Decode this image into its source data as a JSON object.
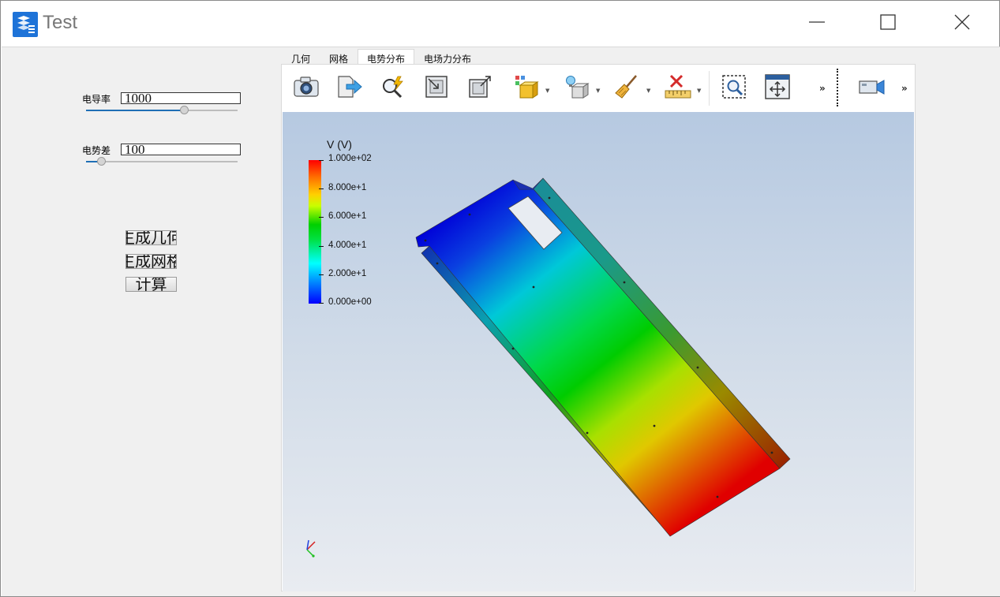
{
  "window": {
    "title": "Test"
  },
  "left_panel": {
    "conductivity": {
      "label": "电导率",
      "value": "1000",
      "slider_fraction": 0.66
    },
    "potential_diff": {
      "label": "电势差",
      "value": "100",
      "slider_fraction": 0.08
    },
    "buttons": {
      "gen_geometry": "生成几何",
      "gen_mesh": "生成网格",
      "compute": "计算"
    }
  },
  "tabs": [
    {
      "label": "几何"
    },
    {
      "label": "网格"
    },
    {
      "label": "电势分布"
    },
    {
      "label": "电场力分布"
    }
  ],
  "active_tab": "电势分布",
  "toolbar": {
    "more_1": "»",
    "more_2": "»"
  },
  "legend": {
    "title": "V (V)",
    "labels": [
      "1.000e+02",
      "8.000e+1",
      "6.000e+1",
      "4.000e+1",
      "2.000e+1",
      "0.000e+00"
    ],
    "min": 0,
    "max": 100
  },
  "colors": {
    "accent": "#1f6fb5",
    "app_icon": "#1e73d8",
    "colormap_low": "#0000ff",
    "colormap_high": "#ff0000"
  }
}
